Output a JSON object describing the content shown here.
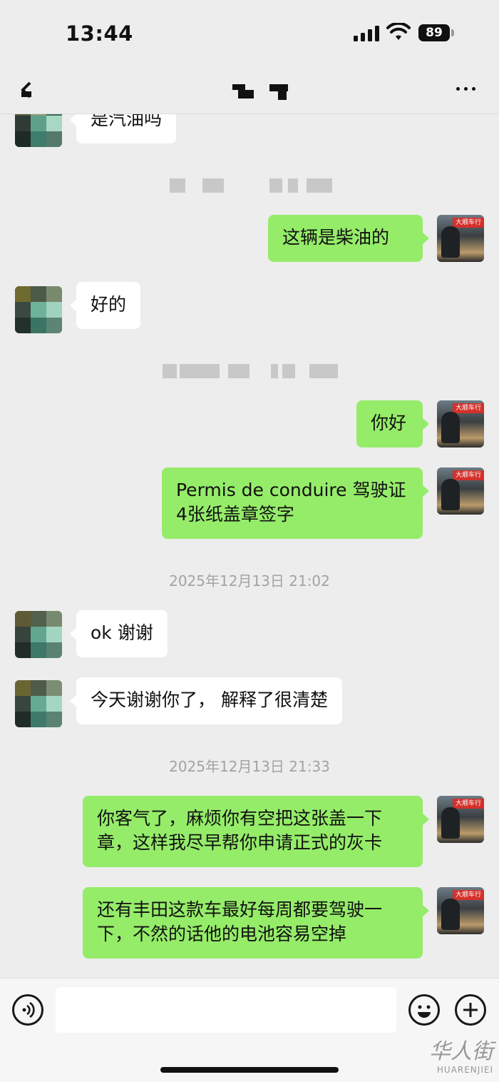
{
  "status_bar": {
    "time": "13:44",
    "battery": "89"
  },
  "nav": {
    "title_redacted": true
  },
  "messages": [
    {
      "side": "left",
      "text": "是汽油吗"
    },
    {
      "side": "right",
      "text": "这辆是柴油的"
    },
    {
      "side": "left",
      "text": "好的"
    },
    {
      "side": "right",
      "text": "你好"
    },
    {
      "side": "right",
      "text": "Permis de conduire 驾驶证\n4张纸盖章签字"
    },
    {
      "side": "left",
      "text": "ok 谢谢"
    },
    {
      "side": "left",
      "text": "今天谢谢你了， 解释了很清楚"
    },
    {
      "side": "right",
      "text": "你客气了，麻烦你有空把这张盖一下\n章，这样我尽早帮你申请正式的灰卡"
    },
    {
      "side": "right",
      "text": "还有丰田这款车最好每周都要驾驶一\n下，不然的话他的电池容易空掉"
    }
  ],
  "timestamps": [
    "2025年12月13日 21:02",
    "2025年12月13日 21:33"
  ],
  "avatar_right_tag": "大顺车行",
  "watermark": {
    "cn": "华人街",
    "en": "HUARENJIEI"
  },
  "colors": {
    "background": "#ededed",
    "bubble_self": "#95ec69",
    "bubble_other": "#ffffff",
    "timestamp": "#a3a3a3"
  },
  "icons": [
    "back-icon",
    "more-icon",
    "voice-icon",
    "emoji-icon",
    "plus-icon"
  ]
}
